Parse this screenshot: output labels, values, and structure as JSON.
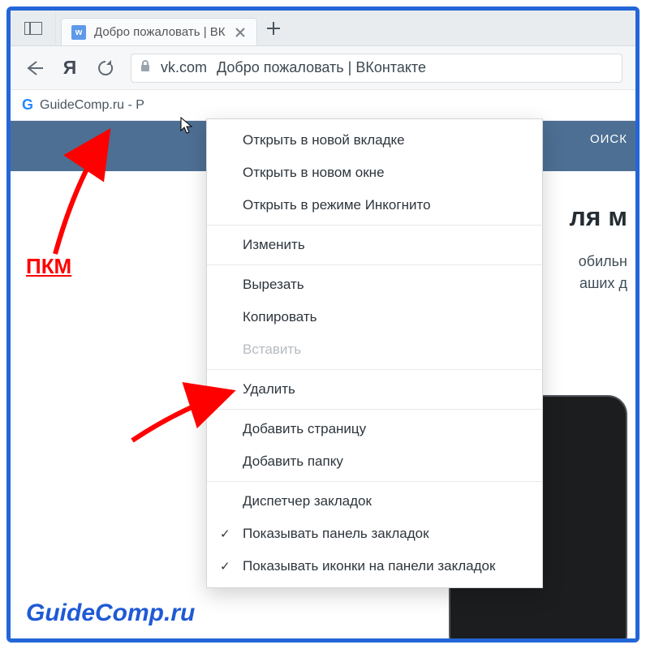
{
  "tab": {
    "favicon_letter": "w",
    "title": "Добро пожаловать | ВК"
  },
  "address": {
    "domain": "vk.com",
    "title": "Добро пожаловать | ВКонтакте"
  },
  "bookmarks_bar": {
    "item0": {
      "icon_letter": "G",
      "label": "GuideComp.ru - Р"
    }
  },
  "vk_page": {
    "search_btn": "ОИСК",
    "headline": "ля м",
    "sub1": "обильн",
    "sub2": "аших д"
  },
  "context_menu": {
    "open_new_tab": "Открыть в новой вкладке",
    "open_new_window": "Открыть в новом окне",
    "open_incognito": "Открыть в режиме Инкогнито",
    "edit": "Изменить",
    "cut": "Вырезать",
    "copy": "Копировать",
    "paste": "Вставить",
    "delete": "Удалить",
    "add_page": "Добавить страницу",
    "add_folder": "Добавить папку",
    "bookmark_manager": "Диспетчер закладок",
    "show_bookmarks_bar": "Показывать панель закладок",
    "show_icons": "Показывать иконки на панели закладок"
  },
  "annotations": {
    "pkm_label": "ПКМ",
    "watermark": "GuideComp.ru"
  }
}
